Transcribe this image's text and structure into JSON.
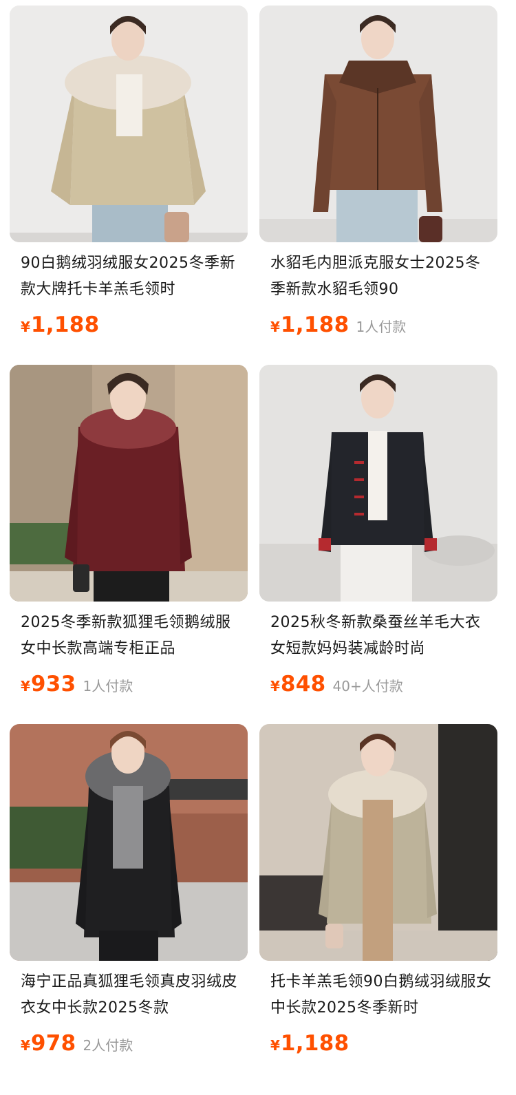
{
  "products": [
    {
      "title": "90白鹅绒羽绒服女2025冬季新款大牌托卡羊羔毛领时",
      "currency": "¥",
      "price": "1,188",
      "sold": ""
    },
    {
      "title": "水貂毛内胆派克服女士2025冬季新款水貂毛领90",
      "currency": "¥",
      "price": "1,188",
      "sold": "1人付款"
    },
    {
      "title": "2025冬季新款狐狸毛领鹅绒服女中长款高端专柜正品",
      "currency": "¥",
      "price": "933",
      "sold": "1人付款"
    },
    {
      "title": "2025秋冬新款桑蚕丝羊毛大衣女短款妈妈装减龄时尚",
      "currency": "¥",
      "price": "848",
      "sold": "40+人付款"
    },
    {
      "title": "海宁正品真狐狸毛领真皮羽绒皮衣女中长款2025冬款",
      "currency": "¥",
      "price": "978",
      "sold": "2人付款"
    },
    {
      "title": "托卡羊羔毛领90白鹅绒羽绒服女中长款2025冬季新时",
      "currency": "¥",
      "price": "1,188",
      "sold": ""
    }
  ],
  "colors": {
    "price": "#ff5000",
    "sold": "#999999",
    "title": "#1a1a1a"
  }
}
